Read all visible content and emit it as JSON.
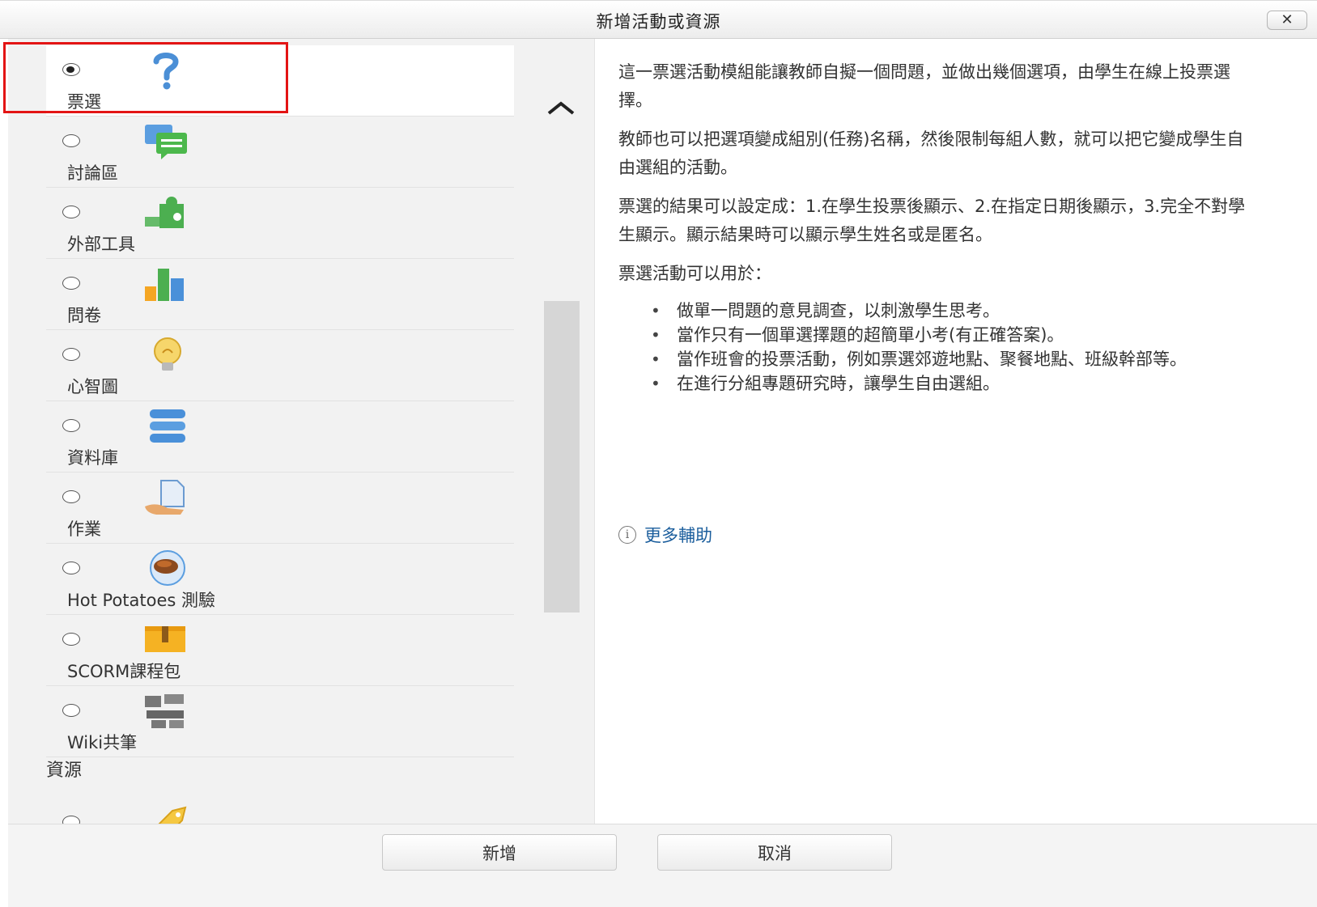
{
  "dialog": {
    "title": "新增活動或資源",
    "close_label": "✕"
  },
  "activities": [
    {
      "label": "票選",
      "icon": "question-mark-icon",
      "selected": true
    },
    {
      "label": "討論區",
      "icon": "chat-bubbles-icon",
      "selected": false
    },
    {
      "label": "外部工具",
      "icon": "puzzle-piece-icon",
      "selected": false
    },
    {
      "label": "問卷",
      "icon": "bar-chart-icon",
      "selected": false
    },
    {
      "label": "心智圖",
      "icon": "lightbulb-icon",
      "selected": false
    },
    {
      "label": "資料庫",
      "icon": "database-icon",
      "selected": false
    },
    {
      "label": "作業",
      "icon": "assignment-hand-icon",
      "selected": false
    },
    {
      "label": "Hot Potatoes 測驗",
      "icon": "hot-potato-icon",
      "selected": false
    },
    {
      "label": "SCORM課程包",
      "icon": "package-box-icon",
      "selected": false
    },
    {
      "label": "Wiki共筆",
      "icon": "wiki-pieces-icon",
      "selected": false
    }
  ],
  "resources_header": "資源",
  "resource_first": {
    "icon": "tag-label-icon"
  },
  "description": {
    "p1": "這一票選活動模組能讓教師自擬一個問題，並做出幾個選項，由學生在線上投票選擇。",
    "p2": "教師也可以把選項變成組別(任務)名稱，然後限制每組人數，就可以把它變成學生自由選組的活動。",
    "p3": "票選的結果可以設定成：1.在學生投票後顯示、2.在指定日期後顯示，3.完全不對學生顯示。顯示結果時可以顯示學生姓名或是匿名。",
    "p4": "票選活動可以用於：",
    "bullets": [
      "做單一問題的意見調查，以刺激學生思考。",
      "當作只有一個單選擇題的超簡單小考(有正確答案)。",
      "當作班會的投票活動，例如票選郊遊地點、聚餐地點、班級幹部等。",
      "在進行分組專題研究時，讓學生自由選組。"
    ],
    "more_help": "更多輔助"
  },
  "footer": {
    "add_label": "新增",
    "cancel_label": "取消"
  },
  "colors": {
    "highlight": "#e31414",
    "link": "#1a5d9c"
  }
}
